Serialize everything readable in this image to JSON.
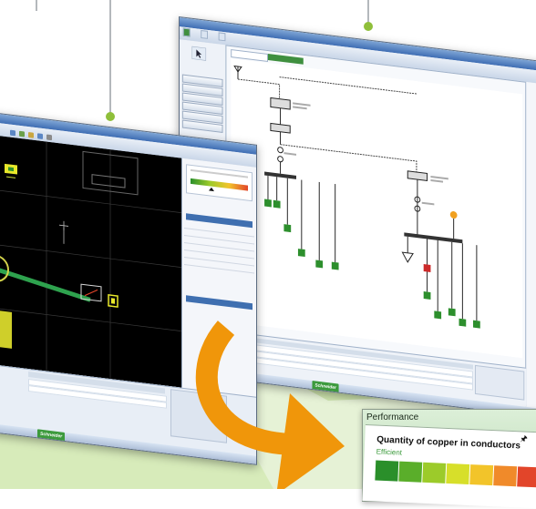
{
  "colors": {
    "accent_orange": "#f0960a",
    "callout_green": "#8fbf3a",
    "ground_green": "#d7ebba",
    "brand_green": "#3c9a3c"
  },
  "back_window": {
    "title": "",
    "tabs": [
      "",
      "",
      ""
    ],
    "doc_tabs": [
      "",
      ""
    ],
    "status_items": [
      "",
      "",
      ""
    ]
  },
  "front_window": {
    "title": "",
    "property_rows": [
      "",
      "",
      "",
      "",
      "",
      ""
    ],
    "status_items": [
      "",
      "",
      ""
    ]
  },
  "brand": {
    "logo_text": "Schneider"
  },
  "performance": {
    "panel_title": "Performance",
    "heading": "Quantity of copper in conductors",
    "rating_label": "Efficient",
    "pin_icon": "pin-icon",
    "close_icon": "close-icon",
    "scale_colors": [
      "#2a8f2a",
      "#5aae2a",
      "#9ccb2a",
      "#d7df2a",
      "#f2c42a",
      "#f08a2a",
      "#e2452a"
    ]
  }
}
